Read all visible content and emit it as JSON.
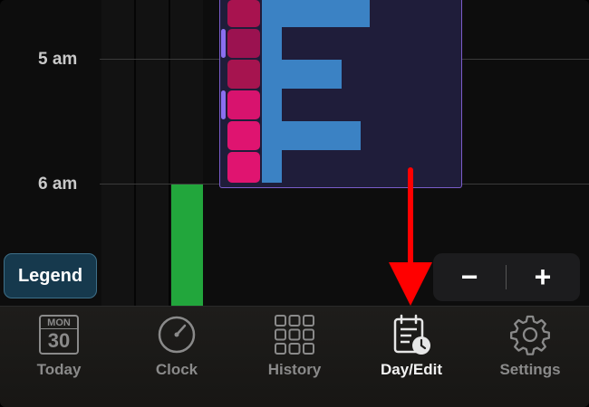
{
  "timeline": {
    "hours": [
      {
        "label": "5 am"
      },
      {
        "label": "6 am"
      }
    ]
  },
  "legend_button": {
    "label": "Legend"
  },
  "zoom": {
    "minus_label": "−",
    "plus_label": "+"
  },
  "tabs": [
    {
      "label": "Today",
      "icon": "calendar-icon",
      "month": "MON",
      "day": "30",
      "active": false
    },
    {
      "label": "Clock",
      "icon": "clock-icon",
      "active": false
    },
    {
      "label": "History",
      "icon": "grid-icon",
      "active": false
    },
    {
      "label": "Day/Edit",
      "icon": "clipboard-clock-icon",
      "active": true
    },
    {
      "label": "Settings",
      "icon": "gear-icon",
      "active": false
    }
  ],
  "colors": {
    "accent_arrow": "#ff0000",
    "event_bar": "#3b82c4",
    "green_activity": "#22a63c",
    "block_border": "#7a5cc9"
  }
}
